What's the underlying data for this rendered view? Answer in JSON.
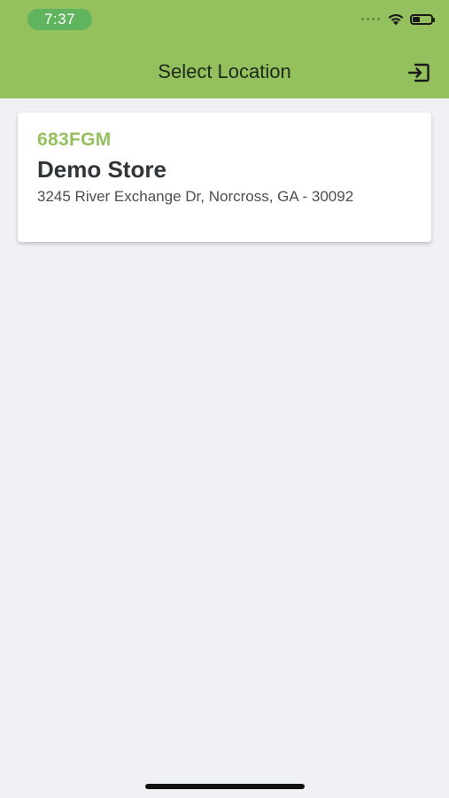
{
  "status_bar": {
    "time": "7:37"
  },
  "header": {
    "title": "Select Location",
    "logout_icon": "logout-icon"
  },
  "locations": [
    {
      "code": "683FGM",
      "name": "Demo Store",
      "address": "3245 River Exchange Dr, Norcross, GA - 30092"
    }
  ],
  "colors": {
    "brand_green": "#95c05e",
    "status_pill": "#5fb45d",
    "background": "#f0f1f5",
    "text_dark": "#303538"
  }
}
